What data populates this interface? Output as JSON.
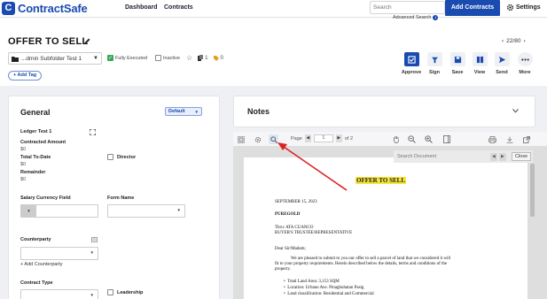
{
  "app": {
    "logo": "ContractSafe",
    "nav": [
      "Dashboard",
      "Contracts"
    ],
    "search_placeholder": "Search",
    "advanced_search": "Advanced Search",
    "add_contracts": "Add Contracts",
    "settings": "Settings"
  },
  "contract": {
    "title": "OFFER TO SELL",
    "pager": "22/80",
    "folder": "...dmin Subfolder Test 1",
    "fully_executed": "Fully Executed",
    "inactive": "Inactive",
    "files_count": "1",
    "tags_count": "0",
    "add_tag": "Add Tag"
  },
  "actions": [
    {
      "label": "Approve",
      "icon": "approve-check-icon"
    },
    {
      "label": "Sign",
      "icon": "sign-pen-icon"
    },
    {
      "label": "Save",
      "icon": "save-disk-icon"
    },
    {
      "label": "View",
      "icon": "view-book-icon"
    },
    {
      "label": "Send",
      "icon": "send-arrow-icon"
    },
    {
      "label": "More",
      "icon": "more-dots-icon"
    }
  ],
  "general": {
    "title": "General",
    "view_select": "Default",
    "ledger": "Ledger Test 1",
    "contracted_amount_label": "Contracted Amount",
    "contracted_amount_value": "$0",
    "total_to_date_label": "Total To-Date",
    "total_to_date_value": "$0",
    "remainder_label": "Remainder",
    "remainder_value": "$0",
    "director_label": "Director",
    "salary_currency_label": "Salary Currency Field",
    "form_name_label": "Form Name",
    "counterparty_label": "Counterparty",
    "add_counterparty": "+ Add Counterparty",
    "contract_type_label": "Contract Type",
    "leadership_label": "Leadership"
  },
  "notes": {
    "title": "Notes"
  },
  "viewer": {
    "page_label": "Page",
    "page_number": "1",
    "page_of": "of 2",
    "search_placeholder": "Search Document",
    "close": "Close"
  },
  "document": {
    "heading": "OFFER TO SELL",
    "date": "SEPTEMBER 15, 2023",
    "company": "PUREGOLD",
    "thru": "Thru: ATA CUANCO",
    "role": "BUYER'S TRUSTEE/REPRESENTATIVE",
    "salutation": "Dear Sir/Madam;",
    "body_1": "We are pleased to submit to you our offer to sell a parcel of land that we considered it will",
    "body_2": "fit to your property requirements. Herein described below the details, terms and conditions of the",
    "body_3": "property.",
    "bullets": [
      "Total Land Area: 3,153 SQM",
      "Location: Urbano Ave. Pinagbuhatan Pasig",
      "Land classification: Residential and Commercial"
    ]
  },
  "colors": {
    "brand": "#1a4bb0",
    "accent_red": "#e02020",
    "highlight": "#f5e53a"
  }
}
